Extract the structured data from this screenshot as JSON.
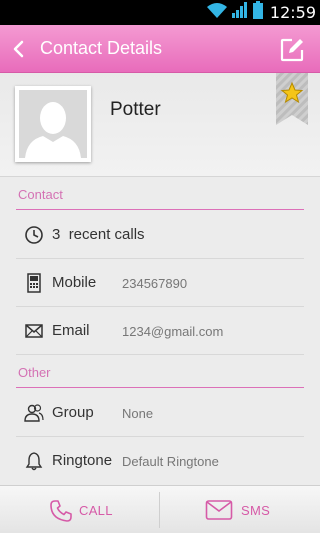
{
  "status_bar": {
    "time": "12:59"
  },
  "action_bar": {
    "title": "Contact Details"
  },
  "contact": {
    "name": "Potter"
  },
  "sections": {
    "contact": "Contact",
    "other": "Other"
  },
  "rows": {
    "recent_calls": {
      "count": "3",
      "label": "recent calls"
    },
    "mobile": {
      "label": "Mobile",
      "value": "234567890"
    },
    "email": {
      "label": "Email",
      "value": "1234@gmail.com"
    },
    "group": {
      "label": "Group",
      "value": "None"
    },
    "ringtone": {
      "label": "Ringtone",
      "value": "Default Ringtone"
    }
  },
  "bottom_bar": {
    "call_label": "CALL",
    "sms_label": "SMS"
  },
  "colors": {
    "accent": "#e86cbb",
    "accent_text": "#d472b4",
    "star": "#f5c518"
  },
  "icons": [
    "wifi-icon",
    "signal-icon",
    "battery-icon",
    "back-icon",
    "edit-icon",
    "star-icon",
    "clock-icon",
    "phone-icon",
    "mail-icon",
    "group-icon",
    "bell-icon",
    "call-icon",
    "sms-icon"
  ]
}
